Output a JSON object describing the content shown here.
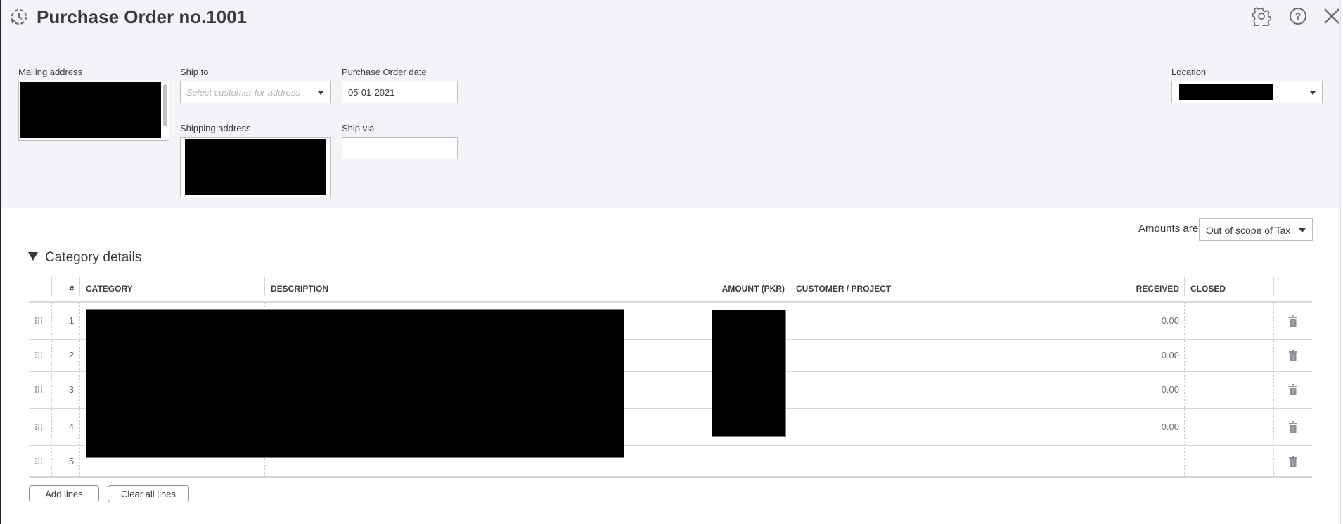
{
  "header": {
    "title": "Purchase Order no.1001",
    "icons": {
      "history": "history-clock-icon",
      "settings": "gear-icon",
      "help": "help-icon",
      "close": "close-icon"
    }
  },
  "form": {
    "mailing_address": {
      "label": "Mailing address",
      "value": "[redacted]"
    },
    "ship_to": {
      "label": "Ship to",
      "placeholder": "Select customer for address"
    },
    "po_date": {
      "label": "Purchase Order date",
      "value": "05-01-2021"
    },
    "shipping_address": {
      "label": "Shipping address",
      "value": "[redacted]"
    },
    "ship_via": {
      "label": "Ship via",
      "value": ""
    },
    "location": {
      "label": "Location",
      "value": "[redacted]"
    }
  },
  "amounts": {
    "label": "Amounts are",
    "selected": "Out of scope of Tax"
  },
  "category_details": {
    "title": "Category details",
    "columns": [
      "#",
      "CATEGORY",
      "DESCRIPTION",
      "AMOUNT (PKR)",
      "CUSTOMER / PROJECT",
      "RECEIVED",
      "CLOSED"
    ],
    "rows": [
      {
        "num": "1",
        "category": "[redacted]",
        "description": "[redacted]",
        "amount": "[redacted]",
        "customer": "",
        "received": "0.00",
        "closed": ""
      },
      {
        "num": "2",
        "category": "[redacted]",
        "description": "[redacted]",
        "amount": "[redacted]",
        "customer": "",
        "received": "0.00",
        "closed": ""
      },
      {
        "num": "3",
        "category": "[redacted]",
        "description": "[redacted]",
        "amount": "[redacted]",
        "customer": "",
        "received": "0.00",
        "closed": ""
      },
      {
        "num": "4",
        "category": "[redacted]",
        "description": "[redacted]",
        "amount": "[redacted]",
        "customer": "",
        "received": "0.00",
        "closed": ""
      },
      {
        "num": "5",
        "category": "",
        "description": "",
        "amount": "",
        "customer": "",
        "received": "",
        "closed": ""
      }
    ]
  },
  "buttons": {
    "add_lines": "Add lines",
    "clear_all_lines": "Clear all lines"
  }
}
